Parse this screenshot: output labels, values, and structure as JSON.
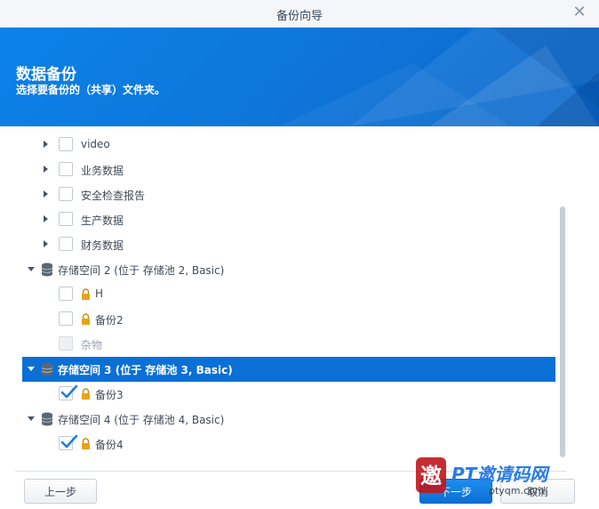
{
  "window": {
    "title": "备份向导",
    "close_glyph": "✕"
  },
  "banner": {
    "heading": "数据备份",
    "subheading": "选择要备份的（共享）文件夹。"
  },
  "tree": [
    {
      "kind": "folder",
      "label": "video",
      "checked": false,
      "expand": "collapsed"
    },
    {
      "kind": "folder",
      "label": "业务数据",
      "checked": false,
      "expand": "collapsed"
    },
    {
      "kind": "folder",
      "label": "安全检查报告",
      "checked": false,
      "expand": "collapsed"
    },
    {
      "kind": "folder",
      "label": "生产数据",
      "checked": false,
      "expand": "collapsed"
    },
    {
      "kind": "folder",
      "label": "财务数据",
      "checked": false,
      "expand": "collapsed"
    },
    {
      "kind": "volume",
      "label": "存储空间 2 (位于 存储池 2, Basic)",
      "expand": "expanded",
      "icon": "database-icon"
    },
    {
      "kind": "folder",
      "label": "H",
      "checked": false,
      "locked": true,
      "icon": "lock-icon"
    },
    {
      "kind": "folder",
      "label": "备份2",
      "checked": false,
      "locked": true,
      "icon": "lock-icon"
    },
    {
      "kind": "folder",
      "label": "杂物",
      "checked": false,
      "disabled": true
    },
    {
      "kind": "volume",
      "label": "存储空间 3 (位于 存储池 3, Basic)",
      "expand": "expanded",
      "selected": true,
      "icon": "database-icon"
    },
    {
      "kind": "folder",
      "label": "备份3",
      "checked": true,
      "locked": true,
      "icon": "lock-icon"
    },
    {
      "kind": "volume",
      "label": "存储空间 4 (位于 存储池 4, Basic)",
      "expand": "expanded",
      "icon": "database-icon"
    },
    {
      "kind": "folder",
      "label": "备份4",
      "checked": true,
      "locked": true,
      "icon": "lock-icon"
    }
  ],
  "footer": {
    "prev_label": "上一步",
    "next_label": "下一步",
    "cancel_label": "取消"
  },
  "watermark": {
    "brand": "PT邀请码网",
    "url": "ptyqm.com"
  },
  "colors": {
    "accent": "#0a70d6",
    "banner": "#0b82e8",
    "check": "#1a7fe0",
    "lock": "#e8a317"
  }
}
